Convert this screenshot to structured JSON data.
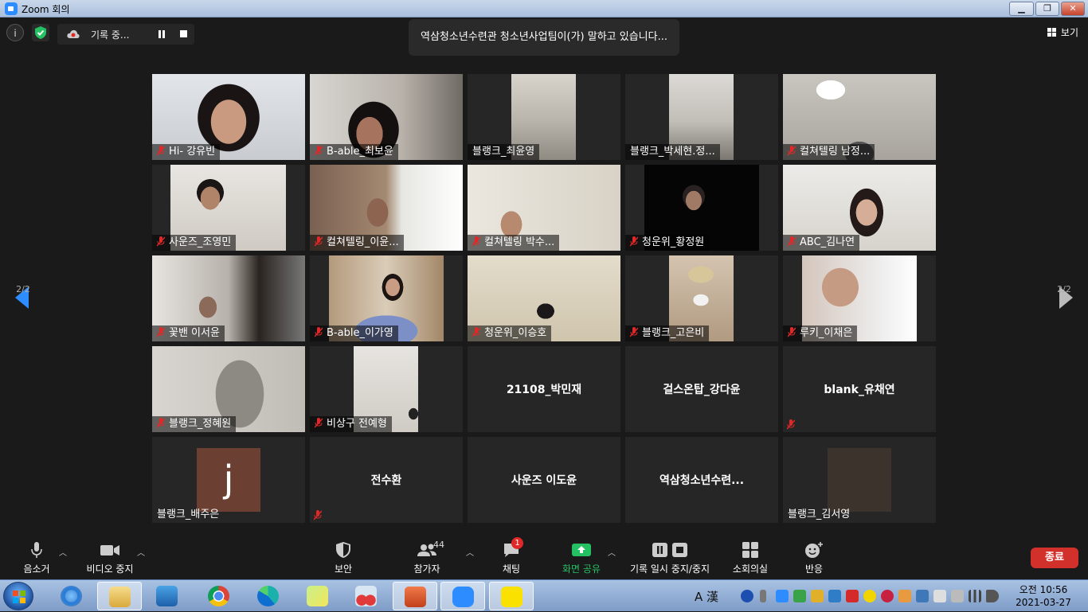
{
  "window": {
    "title": "Zoom 회의"
  },
  "topbar": {
    "recording_label": "기록 중...",
    "speaker_banner": "역삼청소년수련관 청소년사업팀이(가) 말하고 있습니다...",
    "view_label": "보기"
  },
  "pager": {
    "left": "2/2",
    "right": "2/2"
  },
  "tiles": [
    {
      "name": "Hi- 강유빈"
    },
    {
      "name": "B-able_최보윤"
    },
    {
      "name": "블랭크_최윤영"
    },
    {
      "name": "블랭크_박세현.정..."
    },
    {
      "name": "컬쳐텔링 남정..."
    },
    {
      "name": "사운즈_조영민"
    },
    {
      "name": "컬쳐텔링_이윤..."
    },
    {
      "name": "컬쳐텔링 박수..."
    },
    {
      "name": "청운위_황정원"
    },
    {
      "name": "ABC_김나연"
    },
    {
      "name": "꽃밴 이서윤"
    },
    {
      "name": "B-able_이가영"
    },
    {
      "name": "청운위_이승호"
    },
    {
      "name": "블랭크_고은비"
    },
    {
      "name": "루키_이채은"
    },
    {
      "name": "블랭크_정혜원"
    },
    {
      "name": "비상구 전예형"
    },
    {
      "name": "21108_박민재"
    },
    {
      "name": "걸스온탑_강다윤"
    },
    {
      "name": "blank_유채연"
    },
    {
      "name": "블랭크_배주은",
      "avatar_letter": "j"
    },
    {
      "name": "전수환"
    },
    {
      "name": "사운즈 이도윤"
    },
    {
      "name": "역삼청소년수련..."
    },
    {
      "name": "블랭크_김서영"
    }
  ],
  "toolbar": {
    "mute": "음소거",
    "video": "비디오 중지",
    "security": "보안",
    "participants": "참가자",
    "participants_count": "44",
    "chat": "채팅",
    "chat_badge": "1",
    "share": "화면 공유",
    "record": "기록 일시 중지/중지",
    "breakout": "소회의실",
    "reactions": "반응",
    "end": "종료"
  },
  "taskbar": {
    "ime": "A 漢",
    "time": "오전 10:56",
    "date": "2021-03-27"
  },
  "colors": {
    "zoom_blue": "#2d8cff",
    "share_green": "#25c063",
    "end_red": "#d2302b",
    "chat_badge_red": "#e02828"
  }
}
